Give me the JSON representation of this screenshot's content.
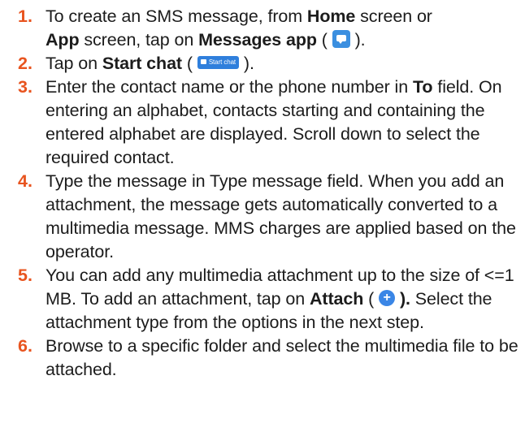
{
  "steps": [
    {
      "number": "1.",
      "text_a": "To create an SMS message, from ",
      "bold_home": "Home",
      "text_b": " screen or ",
      "bold_app": "App",
      "text_c": " screen, tap on ",
      "bold_messages": "Messages app",
      "text_d": " ( ",
      "icon": "messages-app-icon",
      "text_e": " )."
    },
    {
      "number": "2.",
      "text_a": "Tap on ",
      "bold_start": "Start chat",
      "text_b": " ( ",
      "icon": "start-chat-icon",
      "icon_label": "Start chat",
      "text_c": " )."
    },
    {
      "number": "3.",
      "text_a": "Enter the contact name or the phone number in ",
      "bold_to": "To",
      "text_b": " field. On entering an alphabet, contacts starting and containing the entered alphabet are displayed. Scroll down to select the required contact."
    },
    {
      "number": "4.",
      "text": "Type the message in Type message field. When you add an attachment, the message gets automatically converted to a multimedia message. MMS charges are applied based on the operator."
    },
    {
      "number": "5.",
      "text_a": "You can add any multimedia attachment up to the size of <=1 MB. To add an attachment, tap on ",
      "bold_attach": "Attach",
      "text_b": " ( ",
      "icon": "attach-plus-icon",
      "icon_glyph": "+",
      "bold_close": " ).",
      "text_c": " Select the attachment type from the options in the next step."
    },
    {
      "number": "6.",
      "text": "Browse to a specific folder and select the multimedia file to be attached."
    }
  ],
  "colors": {
    "step_number": "#e8541f",
    "icon_blue": "#3b8fe0"
  }
}
